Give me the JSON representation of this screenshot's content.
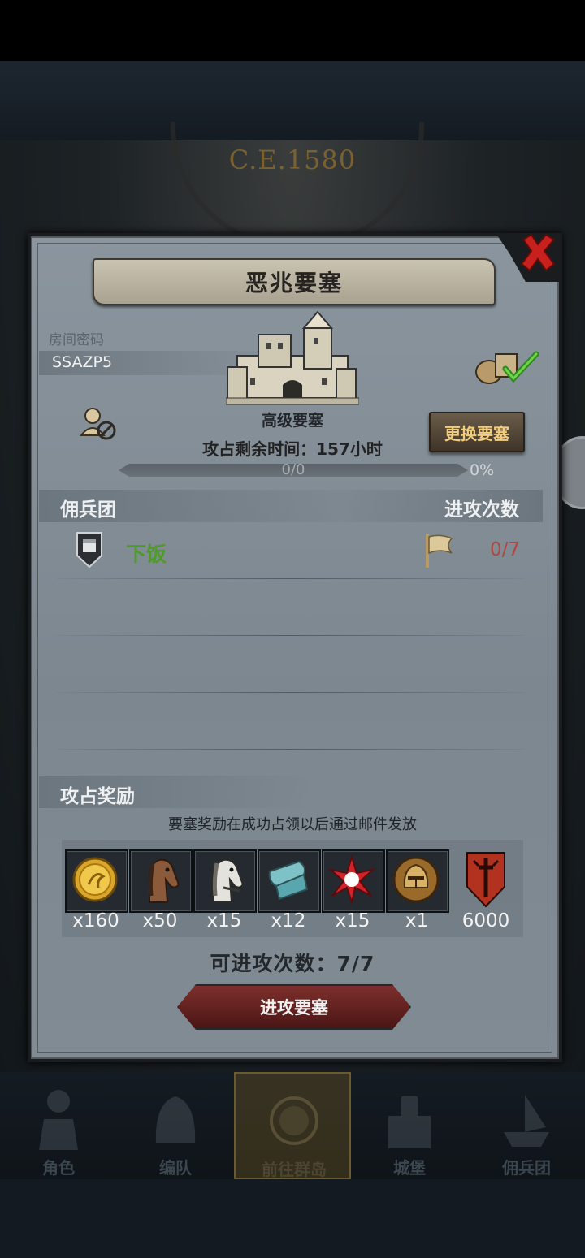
{
  "background": {
    "era_label": "C.E.1580"
  },
  "dialog": {
    "title": "恶兆要塞",
    "room": {
      "label": "房间密码",
      "code": "SSAZP5"
    },
    "fortress": {
      "name": "高级要塞",
      "time_remaining": "攻占剩余时间：157小时",
      "progress_text": "0/0",
      "progress_percent_text": "0%",
      "progress_fraction": 0
    },
    "change_button_label": "更换要塞",
    "mercenary_section": {
      "title": "佣兵团",
      "attack_count_title": "进攻次数",
      "rows": [
        {
          "name": "下饭",
          "attack_count": "0/7"
        }
      ]
    },
    "reward_section": {
      "title": "攻占奖励",
      "note": "要塞奖励在成功占领以后通过邮件发放",
      "items": [
        {
          "icon": "gold-coin-icon",
          "qty": "x160"
        },
        {
          "icon": "brown-horse-icon",
          "qty": "x50"
        },
        {
          "icon": "white-horse-icon",
          "qty": "x15"
        },
        {
          "icon": "cloth-roll-icon",
          "qty": "x12"
        },
        {
          "icon": "red-star-gem-icon",
          "qty": "x15"
        },
        {
          "icon": "knight-helmet-coin-icon",
          "qty": "x1"
        },
        {
          "icon": "sword-crest-icon",
          "qty": "6000"
        }
      ]
    },
    "attempts_text": "可进攻次数：7/7",
    "attack_button_label": "进攻要塞"
  },
  "nav": {
    "items": [
      {
        "label": "角色",
        "active": false
      },
      {
        "label": "编队",
        "active": false
      },
      {
        "label": "前往群岛",
        "active": true
      },
      {
        "label": "城堡",
        "active": false
      },
      {
        "label": "佣兵团",
        "active": false
      }
    ]
  },
  "colors": {
    "accent_gold": "#f1cd80",
    "attack_red": "#7e2f2c",
    "merc_green": "#4f9b2a"
  }
}
